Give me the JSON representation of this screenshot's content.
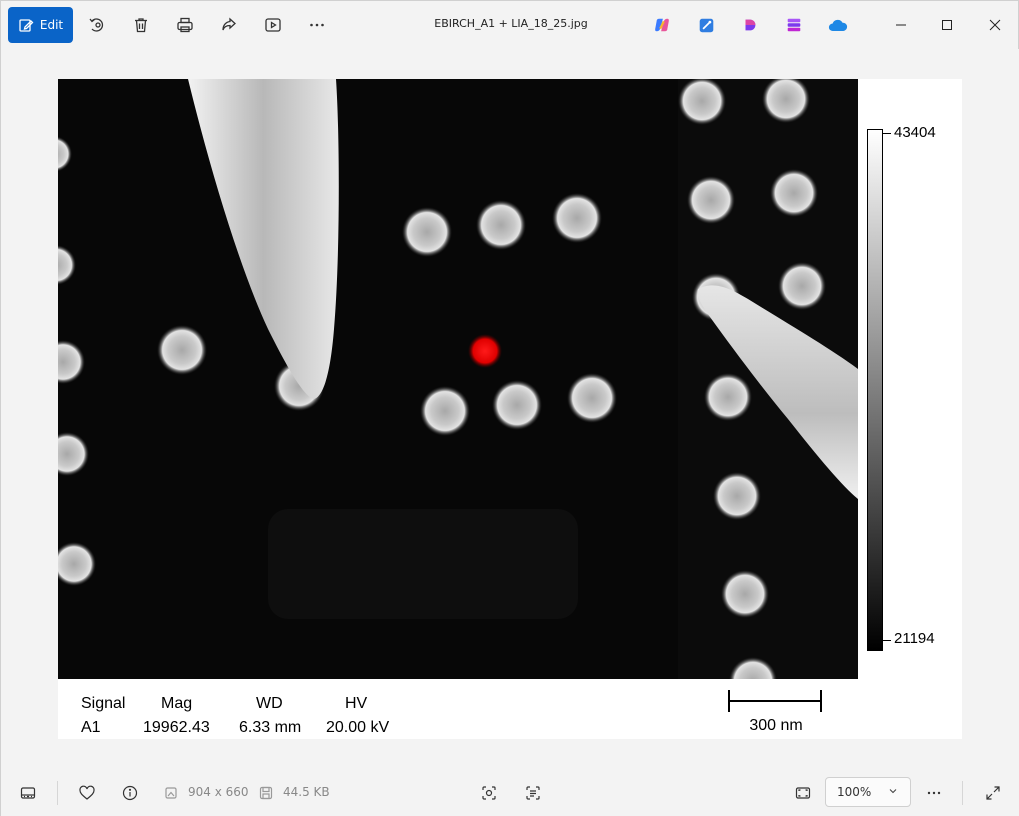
{
  "toolbar": {
    "edit_label": "Edit",
    "file_title": "EBIRCH_A1 + LIA_18_25.jpg"
  },
  "image": {
    "colorbar_max": "43404",
    "colorbar_min": "21194",
    "meta_headers": [
      "Signal",
      "Mag",
      "WD",
      "HV"
    ],
    "meta_values": [
      "A1",
      "19962.43",
      "6.33 mm",
      "20.00 kV"
    ],
    "scale_label": "300 nm"
  },
  "statusbar": {
    "dimensions": "904 x 660",
    "file_size": "44.5 KB",
    "zoom": "100%"
  },
  "colors": {
    "accent": "#0a64c8",
    "marker": "#e01010"
  }
}
